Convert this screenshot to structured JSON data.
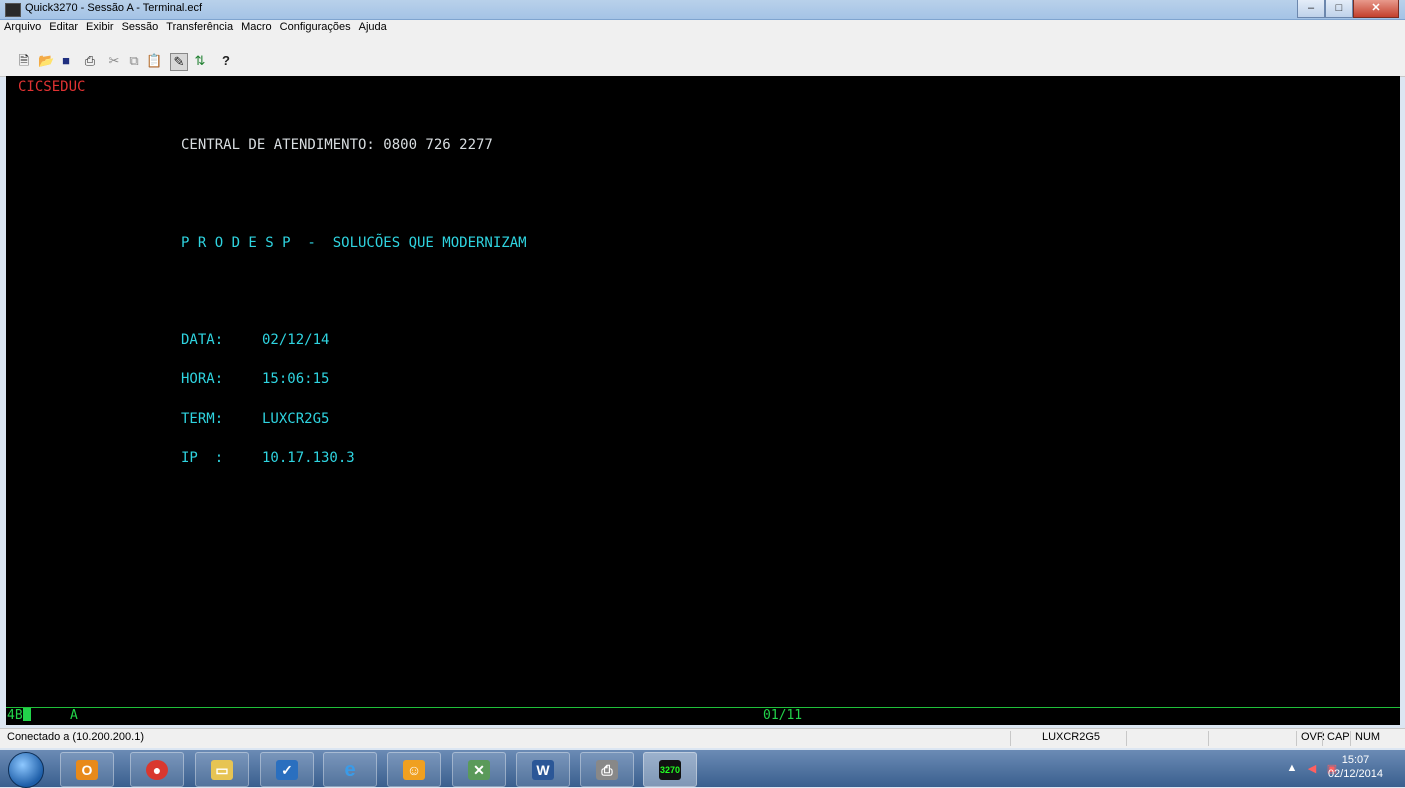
{
  "window": {
    "title": "Quick3270 - Sessão A - Terminal.ecf"
  },
  "menu": [
    "Arquivo",
    "Editar",
    "Exibir",
    "Sessão",
    "Transferência",
    "Macro",
    "Configurações",
    "Ajuda"
  ],
  "terminal": {
    "region": "CICSEDUC",
    "central": "CENTRAL DE ATENDIMENTO: 0800 726 2277",
    "prodesp": "P R O D E S P  -  SOLUCÕES QUE MODERNIZAM",
    "data_label": "DATA:",
    "data_value": "02/12/14",
    "hora_label": "HORA:",
    "hora_value": "15:06:15",
    "term_label": "TERM:",
    "term_value": "LUXCR2G5",
    "ip_label": "IP  :",
    "ip_value": "10.17.130.3"
  },
  "oia": {
    "indicator": "4B",
    "mode": "A",
    "cursor_pos": "01/11"
  },
  "status": {
    "connection": "Conectado a  (10.200.200.1)",
    "lu": "LUXCR2G5",
    "ovr": "OVR",
    "cap": "CAP",
    "num": "NUM"
  },
  "tray": {
    "time": "15:07",
    "date": "02/12/2014"
  },
  "colors": {
    "field_cyan": "#2fd4e0",
    "region_red": "#e03232",
    "oia_green": "#22d44a"
  },
  "taskbar_icons": [
    "outlook-icon",
    "chrome-icon",
    "explorer-icon",
    "taskmanager-icon",
    "ie-icon",
    "outlook-calendar-icon",
    "users-icon",
    "word-icon",
    "printer-icon",
    "quick3270-icon"
  ]
}
